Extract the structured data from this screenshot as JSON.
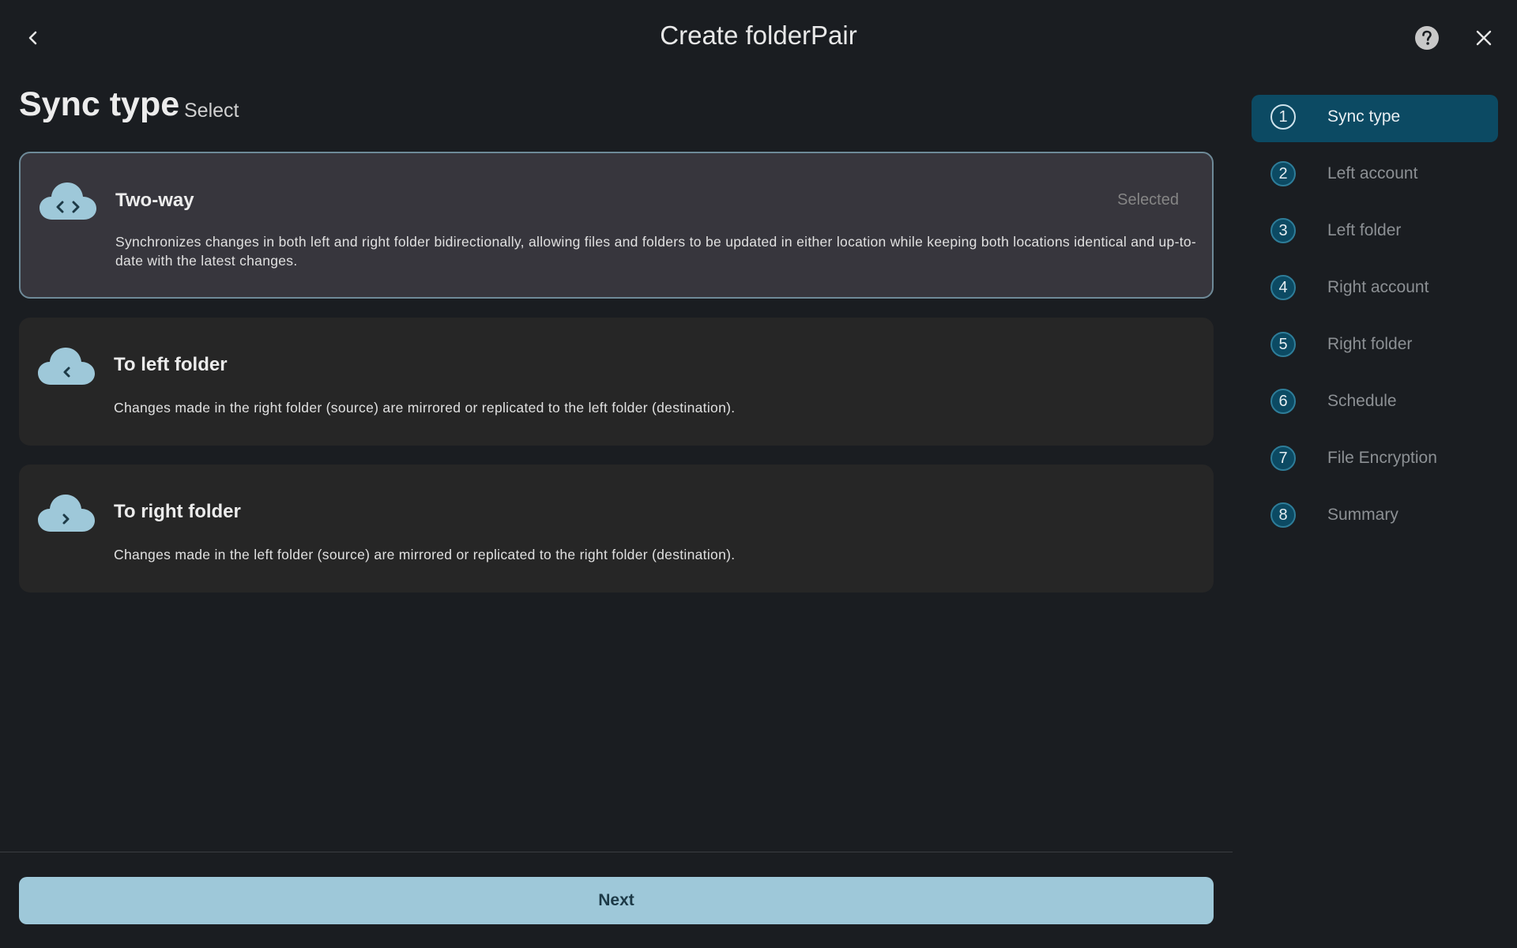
{
  "header": {
    "title": "Create folderPair"
  },
  "section": {
    "title": "Sync type",
    "subtitle": "Select"
  },
  "options": [
    {
      "title": "Two-way",
      "status": "Selected",
      "icon": "cloud-sync-icon",
      "description": "Synchronizes changes in both left and right folder bidirectionally, allowing files and folders to be updated in either location while keeping both locations identical and up-to-date with the latest changes."
    },
    {
      "title": "To left folder",
      "status": "",
      "icon": "cloud-left-icon",
      "description": "Changes made in the right folder (source) are mirrored or replicated to the left folder (destination)."
    },
    {
      "title": "To right folder",
      "status": "",
      "icon": "cloud-right-icon",
      "description": "Changes made in the left folder (source) are mirrored or replicated to the right folder (destination)."
    }
  ],
  "footer": {
    "next_label": "Next"
  },
  "steps": [
    {
      "num": "1",
      "label": "Sync type"
    },
    {
      "num": "2",
      "label": "Left account"
    },
    {
      "num": "3",
      "label": "Left folder"
    },
    {
      "num": "4",
      "label": "Right account"
    },
    {
      "num": "5",
      "label": "Right folder"
    },
    {
      "num": "6",
      "label": "Schedule"
    },
    {
      "num": "7",
      "label": "File Encryption"
    },
    {
      "num": "8",
      "label": "Summary"
    }
  ],
  "active_step": 0,
  "colors": {
    "background": "#1a1d21",
    "accent": "#9ec8d9",
    "active_step": "#0c4a63",
    "card_selected": "#37363d",
    "card": "#262626"
  }
}
